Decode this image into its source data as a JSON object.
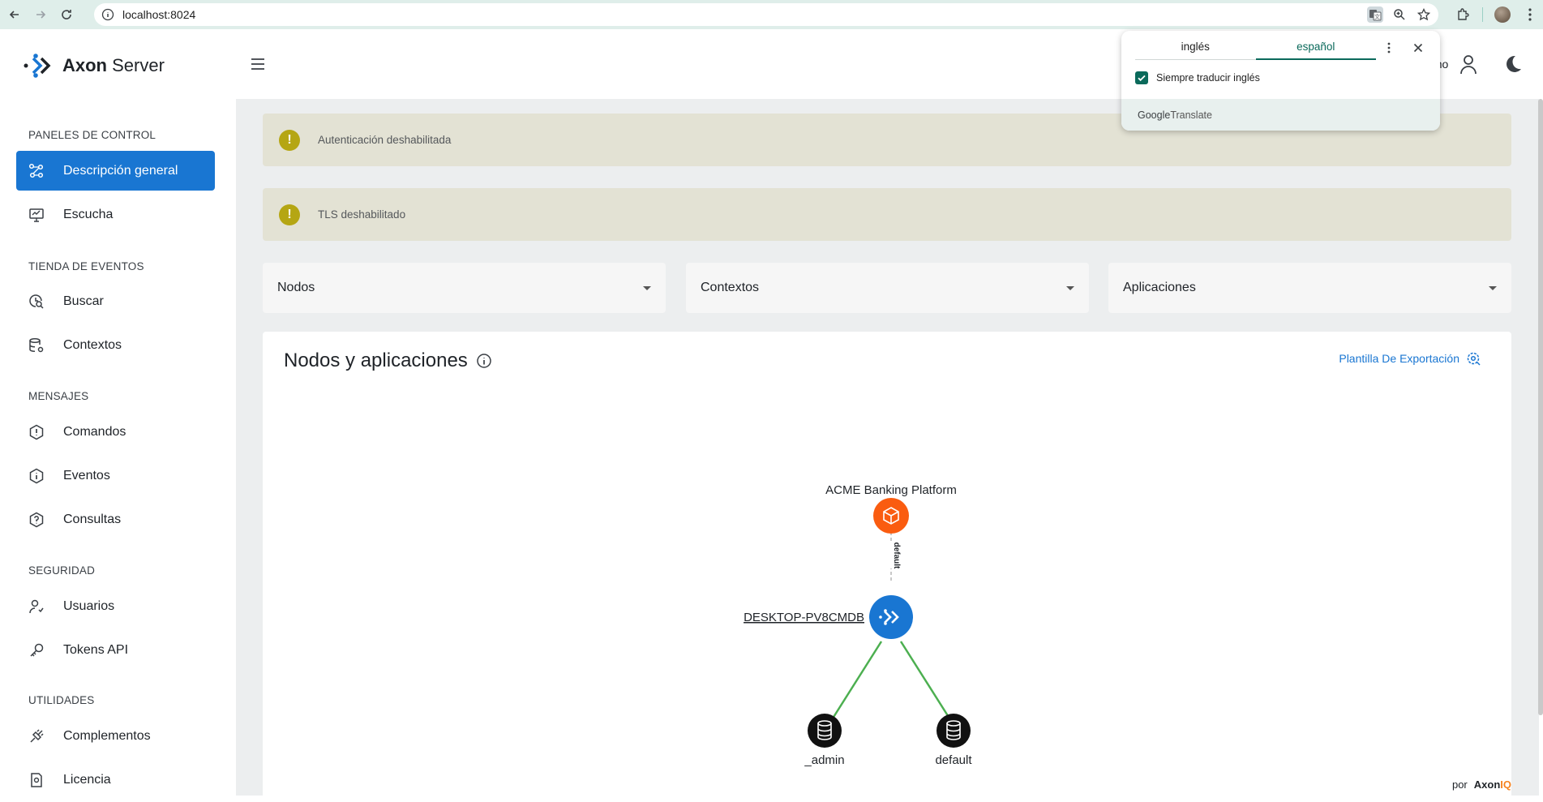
{
  "browser": {
    "url": "localhost:8024"
  },
  "app": {
    "logo_text_bold": "Axon",
    "logo_text_regular": " Server",
    "user_text": "nimo"
  },
  "sidebar": {
    "sections": [
      {
        "title": "PANELES DE CONTROL",
        "items": [
          {
            "label": "Descripción general",
            "icon": "overview-icon",
            "active": true
          },
          {
            "label": "Escucha",
            "icon": "monitor-icon",
            "active": false
          }
        ]
      },
      {
        "title": "TIENDA DE EVENTOS",
        "items": [
          {
            "label": "Buscar",
            "icon": "search-icon",
            "active": false
          },
          {
            "label": "Contextos",
            "icon": "database-gear-icon",
            "active": false
          }
        ]
      },
      {
        "title": "MENSAJES",
        "items": [
          {
            "label": "Comandos",
            "icon": "command-icon",
            "active": false
          },
          {
            "label": "Eventos",
            "icon": "event-icon",
            "active": false
          },
          {
            "label": "Consultas",
            "icon": "query-icon",
            "active": false
          }
        ]
      },
      {
        "title": "SEGURIDAD",
        "items": [
          {
            "label": "Usuarios",
            "icon": "users-icon",
            "active": false
          },
          {
            "label": "Tokens API",
            "icon": "key-icon",
            "active": false
          }
        ]
      },
      {
        "title": "UTILIDADES",
        "items": [
          {
            "label": "Complementos",
            "icon": "plugin-icon",
            "active": false
          },
          {
            "label": "Licencia",
            "icon": "license-icon",
            "active": false
          }
        ]
      }
    ]
  },
  "alerts": [
    {
      "text": "Autenticación deshabilitada",
      "icon": "warning-icon"
    },
    {
      "text": "TLS deshabilitado",
      "icon": "warning-icon"
    }
  ],
  "filters": [
    {
      "label": "Nodos"
    },
    {
      "label": "Contextos"
    },
    {
      "label": "Aplicaciones"
    }
  ],
  "card": {
    "title": "Nodos y aplicaciones",
    "export_label": "Plantilla De Exportación",
    "footer_by": "por",
    "footer_brand_a": "Axon",
    "footer_brand_b": "IQ"
  },
  "graph": {
    "application": {
      "label": "ACME Banking Platform",
      "color": "#fa5c10"
    },
    "edge_label": "default",
    "node": {
      "label": "DESKTOP-PV8CMDB",
      "color": "#1976d2"
    },
    "contexts": [
      {
        "label": "_admin"
      },
      {
        "label": "default"
      }
    ],
    "edge_color": "#4caf50"
  },
  "translate_popup": {
    "tabs": [
      {
        "label": "inglés",
        "selected": false
      },
      {
        "label": "español",
        "selected": true
      }
    ],
    "checkbox_label": "Siempre traducir inglés",
    "checkbox_checked": true,
    "footer_google": "Google",
    "footer_translate": " Translate"
  }
}
